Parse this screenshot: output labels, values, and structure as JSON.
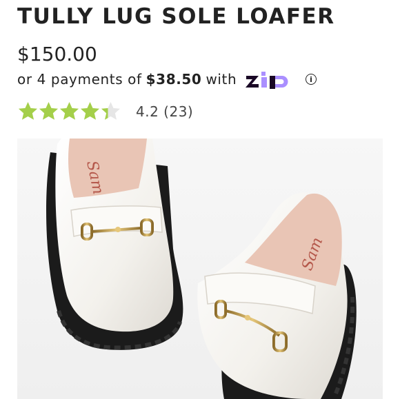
{
  "product": {
    "title": "TULLY LUG SOLE LOAFER",
    "price": "$150.00",
    "payments": {
      "prefix": "or 4 payments of",
      "amount": "$38.50",
      "suffix": "with",
      "provider": "zip",
      "info_icon": "info-icon"
    },
    "rating": {
      "stars": 4.2,
      "text": "4.2 (23)",
      "star_color": "#a4cf4a",
      "empty_star_color": "#e6e6e6"
    },
    "image": {
      "icon": "loafer-shoes-image",
      "brand_script": "Sam"
    }
  },
  "colors": {
    "zip_purple": "#aa8fff",
    "zip_dark": "#1a0826"
  }
}
